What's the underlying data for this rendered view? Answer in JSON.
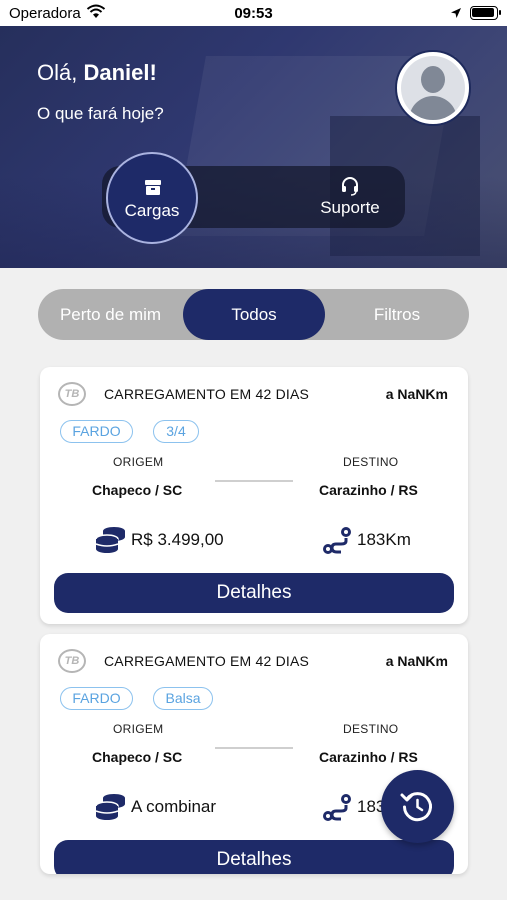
{
  "status_bar": {
    "carrier": "Operadora",
    "time": "09:53"
  },
  "header": {
    "greeting_prefix": "Olá, ",
    "greeting_name": "Daniel!",
    "subtitle": "O que fará hoje?",
    "modes": [
      {
        "label": "Cargas",
        "icon": "box-icon",
        "active": true
      },
      {
        "label": "Suporte",
        "icon": "headset-icon",
        "active": false
      }
    ]
  },
  "filters": {
    "tabs": [
      {
        "label": "Perto de mim",
        "active": false
      },
      {
        "label": "Todos",
        "active": true
      },
      {
        "label": "Filtros",
        "active": false
      }
    ]
  },
  "loads": [
    {
      "logo": "TB",
      "title": "CARREGAMENTO EM 42 DIAS",
      "distance": "a NaNKm",
      "tags": [
        "FARDO",
        "3/4"
      ],
      "origin_label": "ORIGEM",
      "origin": "Chapeco / SC",
      "destination_label": "DESTINO",
      "destination": "Carazinho / RS",
      "price": "R$ 3.499,00",
      "route_distance": "183Km",
      "button": "Detalhes"
    },
    {
      "logo": "TB",
      "title": "CARREGAMENTO EM 42 DIAS",
      "distance": "a NaNKm",
      "tags": [
        "FARDO",
        "Balsa"
      ],
      "origin_label": "ORIGEM",
      "origin": "Chapeco / SC",
      "destination_label": "DESTINO",
      "destination": "Carazinho / RS",
      "price": "A combinar",
      "route_distance": "183Km",
      "button": "Detalhes"
    }
  ],
  "colors": {
    "primary": "#1e2a68",
    "tag": "#5aa3e0",
    "segment_bg": "#b1b1b1",
    "background": "#f0f0f0"
  }
}
